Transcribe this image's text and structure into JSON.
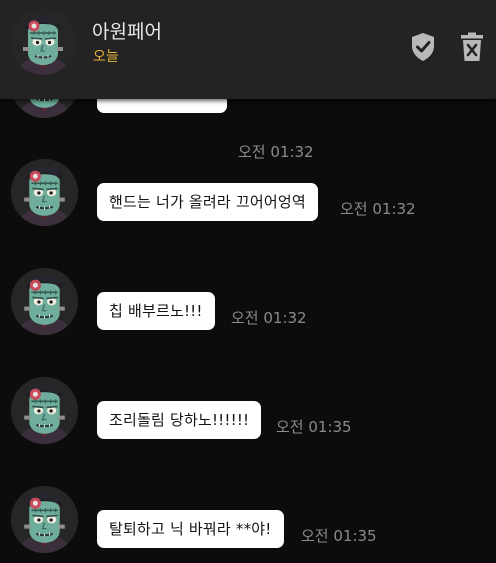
{
  "header": {
    "contact_name": "아원페어",
    "status": "오늘",
    "shield_icon": "shield-check-icon",
    "delete_icon": "trash-can-x-icon"
  },
  "messages": [
    {
      "text": "핸드는 너가 올려라 끄어어엉역",
      "time": "오전 01:32"
    },
    {
      "text": "칩 배부르노!!!",
      "time": "오전 01:32"
    },
    {
      "text": "조리돌림 당하노!!!!!!",
      "time": "오전 01:35"
    },
    {
      "text": "탈퇴하고 닉 바꿔라 **야!",
      "time": "오전 01:35"
    }
  ],
  "partial_message": {
    "time": "오전 01:32"
  },
  "colors": {
    "header_bg": "#232323",
    "chat_bg": "#0c0c0c",
    "bubble_bg": "#ffffff",
    "status_yellow": "#e3b33a",
    "time_gray": "#8b8b8b"
  }
}
